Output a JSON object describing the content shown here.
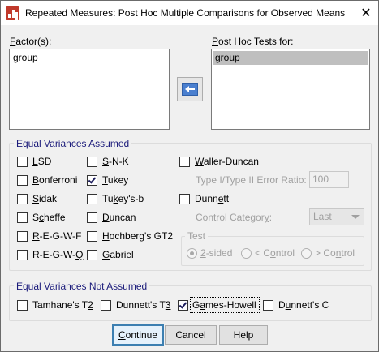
{
  "window": {
    "title": "Repeated Measures: Post Hoc Multiple Comparisons for Observed Means",
    "close_glyph": "✕"
  },
  "factors": {
    "label_pre": "",
    "label_u": "F",
    "label_post": "actor(s):",
    "items": [
      "group"
    ]
  },
  "posthoc": {
    "label_u": "P",
    "label_post": "ost Hoc Tests for:",
    "items": [
      "group"
    ]
  },
  "equal_assumed": {
    "title": "Equal Variances Assumed",
    "tests": {
      "lsd": {
        "u": "L",
        "rest": "SD",
        "pre": "",
        "checked": false
      },
      "bonferroni": {
        "pre": "",
        "u": "B",
        "rest": "onferroni",
        "checked": false
      },
      "sidak": {
        "pre": "",
        "u": "S",
        "rest": "idak",
        "checked": false
      },
      "scheffe": {
        "pre": "S",
        "u": "c",
        "rest": "heffe",
        "checked": false
      },
      "regwf": {
        "pre": "",
        "u": "R",
        "rest": "-E-G-W-F",
        "checked": false
      },
      "regwq": {
        "pre": "R-E-G-W-",
        "u": "Q",
        "rest": "",
        "checked": false
      },
      "snk": {
        "pre": "",
        "u": "S",
        "rest": "-N-K",
        "checked": false
      },
      "tukey": {
        "pre": "",
        "u": "T",
        "rest": "ukey",
        "checked": true
      },
      "tukeyb": {
        "pre": "Tu",
        "u": "k",
        "rest": "ey's-b",
        "checked": false
      },
      "duncan": {
        "pre": "",
        "u": "D",
        "rest": "uncan",
        "checked": false
      },
      "hochberg": {
        "pre": "",
        "u": "H",
        "rest": "ochberg's GT2",
        "checked": false
      },
      "gabriel": {
        "pre": "",
        "u": "G",
        "rest": "abriel",
        "checked": false
      },
      "waller": {
        "pre": "",
        "u": "W",
        "rest": "aller-Duncan",
        "checked": false
      },
      "dunnett": {
        "pre": "Dunn",
        "u": "e",
        "rest": "tt",
        "checked": false
      }
    },
    "error_ratio_label": "Type I/Type II Error Ratio:",
    "error_ratio_value": "100",
    "control_category_label_pre": "Control Categor",
    "control_category_label_u": "y",
    "control_category_label_post": ":",
    "control_category_value": "Last",
    "test": {
      "title": "Test",
      "two_sided": {
        "pre": "",
        "u": "2",
        "rest": "-sided",
        "selected": true
      },
      "lt_control": {
        "pre": "< C",
        "u": "o",
        "rest": "ntrol",
        "selected": false
      },
      "gt_control": {
        "pre": "> Co",
        "u": "n",
        "rest": "trol",
        "selected": false
      }
    }
  },
  "equal_not_assumed": {
    "title": "Equal Variances Not Assumed",
    "tests": {
      "tamhane": {
        "pre": "Tamhane's T",
        "u": "2",
        "rest": "",
        "checked": false
      },
      "dunnett_t3": {
        "pre": "Dunnett's T",
        "u": "3",
        "rest": "",
        "checked": false
      },
      "games_howell": {
        "pre": "G",
        "u": "a",
        "rest": "mes-Howell",
        "checked": true
      },
      "dunnett_c": {
        "pre": "D",
        "u": "u",
        "rest": "nnett's C",
        "checked": false
      }
    }
  },
  "buttons": {
    "continue": {
      "pre": "",
      "u": "C",
      "rest": "ontinue"
    },
    "cancel": {
      "label": "Cancel"
    },
    "help": {
      "label": "Help"
    }
  }
}
